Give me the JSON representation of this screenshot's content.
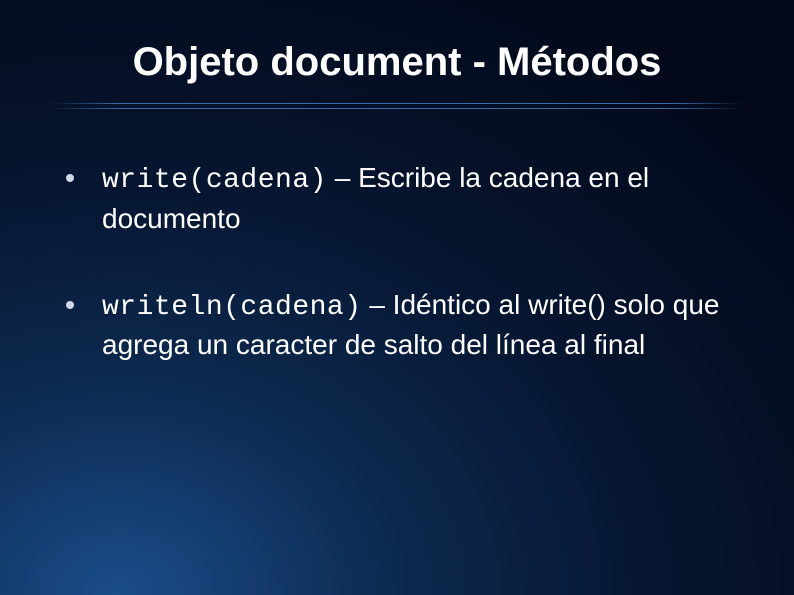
{
  "slide": {
    "title": "Objeto document - Métodos",
    "bullets": [
      {
        "code": "write(cadena)",
        "desc": " – Escribe la cadena en el documento"
      },
      {
        "code": "writeln(cadena)",
        "desc": " – Idéntico al write() solo que agrega un caracter de salto del línea al final"
      }
    ]
  }
}
